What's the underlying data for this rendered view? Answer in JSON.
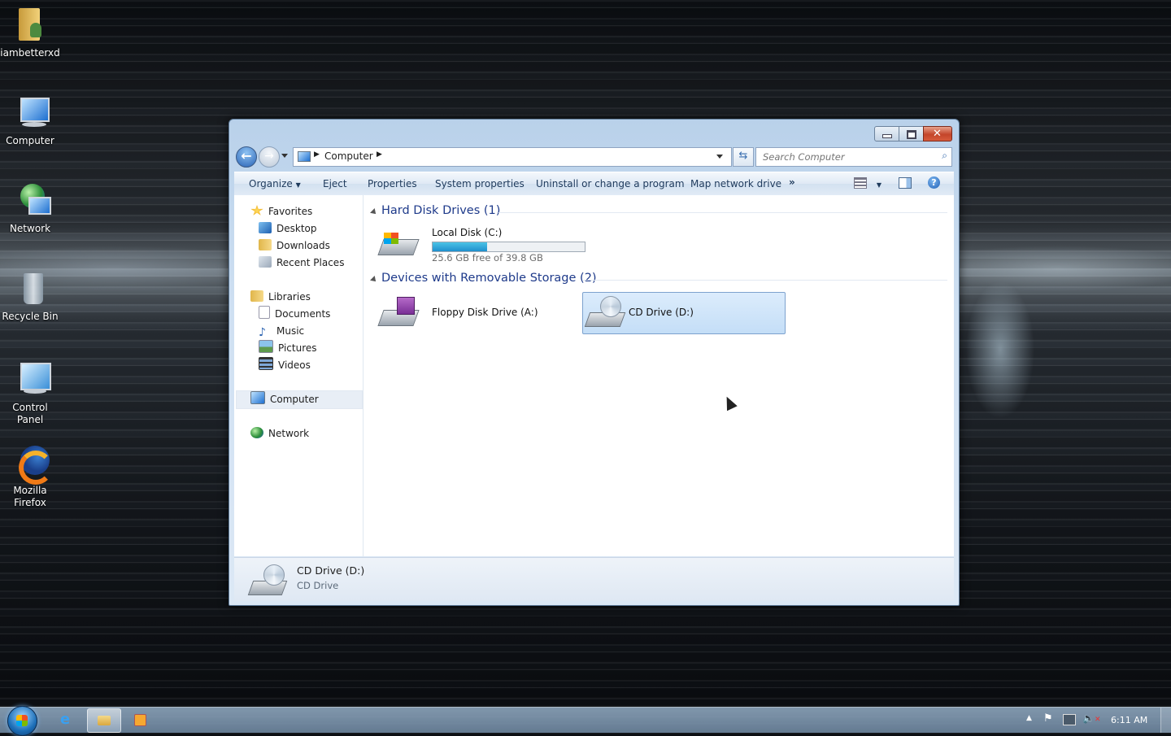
{
  "desktop": {
    "icons": [
      {
        "label": "iambetterxd"
      },
      {
        "label": "Computer"
      },
      {
        "label": "Network"
      },
      {
        "label": "Recycle Bin"
      },
      {
        "label": "Control Panel"
      },
      {
        "label": "Mozilla Firefox"
      }
    ]
  },
  "window": {
    "breadcrumb": [
      "Computer"
    ],
    "search_placeholder": "Search Computer",
    "toolbar": {
      "organize": "Organize",
      "eject": "Eject",
      "properties": "Properties",
      "system_properties": "System properties",
      "uninstall": "Uninstall or change a program",
      "map_network_drive": "Map network drive",
      "more": "»"
    },
    "sidebar": {
      "favorites": "Favorites",
      "desktop": "Desktop",
      "downloads": "Downloads",
      "recent_places": "Recent Places",
      "libraries": "Libraries",
      "documents": "Documents",
      "music": "Music",
      "pictures": "Pictures",
      "videos": "Videos",
      "computer": "Computer",
      "network": "Network"
    },
    "groups": {
      "hdd_title": "Hard Disk Drives (1)",
      "removable_title": "Devices with Removable Storage (2)"
    },
    "drives": {
      "local_disk": {
        "name": "Local Disk (C:)",
        "free_text": "25.6 GB free of 39.8 GB",
        "used_fraction": 0.357
      },
      "floppy": {
        "name": "Floppy Disk Drive (A:)"
      },
      "cd": {
        "name": "CD Drive (D:)"
      }
    },
    "details": {
      "title": "CD Drive (D:)",
      "type": "CD Drive"
    }
  },
  "taskbar": {
    "clock": "6:11 AM"
  },
  "colors": {
    "selection": "#cfe3f7",
    "accent": "#1e3a8a",
    "bar_fill": "#26a0da"
  }
}
